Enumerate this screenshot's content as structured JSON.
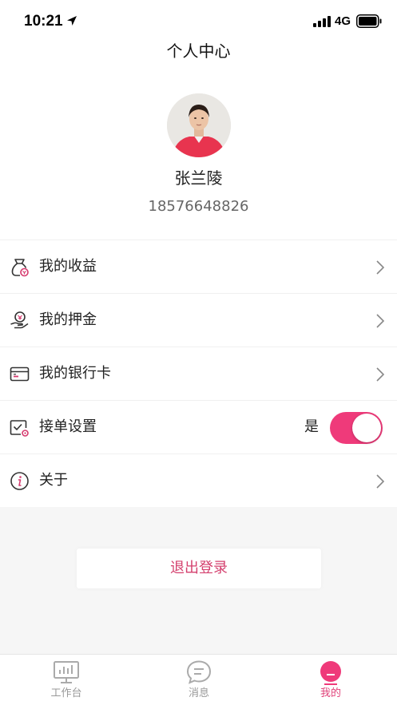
{
  "status_bar": {
    "time": "10:21",
    "network": "4G",
    "icons": [
      "location-arrow-icon",
      "signal-icon",
      "battery-icon"
    ]
  },
  "header": {
    "title": "个人中心",
    "user_name": "张兰陵",
    "phone": "18576648826"
  },
  "menu": {
    "items": [
      {
        "label": "我的收益",
        "icon": "earnings-bag-icon"
      },
      {
        "label": "我的押金",
        "icon": "deposit-hand-icon"
      },
      {
        "label": "我的银行卡",
        "icon": "bank-card-icon"
      },
      {
        "label": "接单设置",
        "icon": "order-settings-icon",
        "toggle_value": "是",
        "toggle_on": true
      },
      {
        "label": "关于",
        "icon": "info-icon"
      }
    ]
  },
  "logout_label": "退出登录",
  "tabbar": {
    "tabs": [
      {
        "label": "工作台",
        "icon": "workbench-icon"
      },
      {
        "label": "消息",
        "icon": "message-icon"
      },
      {
        "label": "我的",
        "icon": "profile-icon",
        "active": true
      }
    ]
  },
  "colors": {
    "accent": "#ef3a7a",
    "logout_text": "#d4406e",
    "icon_accent": "#d63a6e"
  }
}
